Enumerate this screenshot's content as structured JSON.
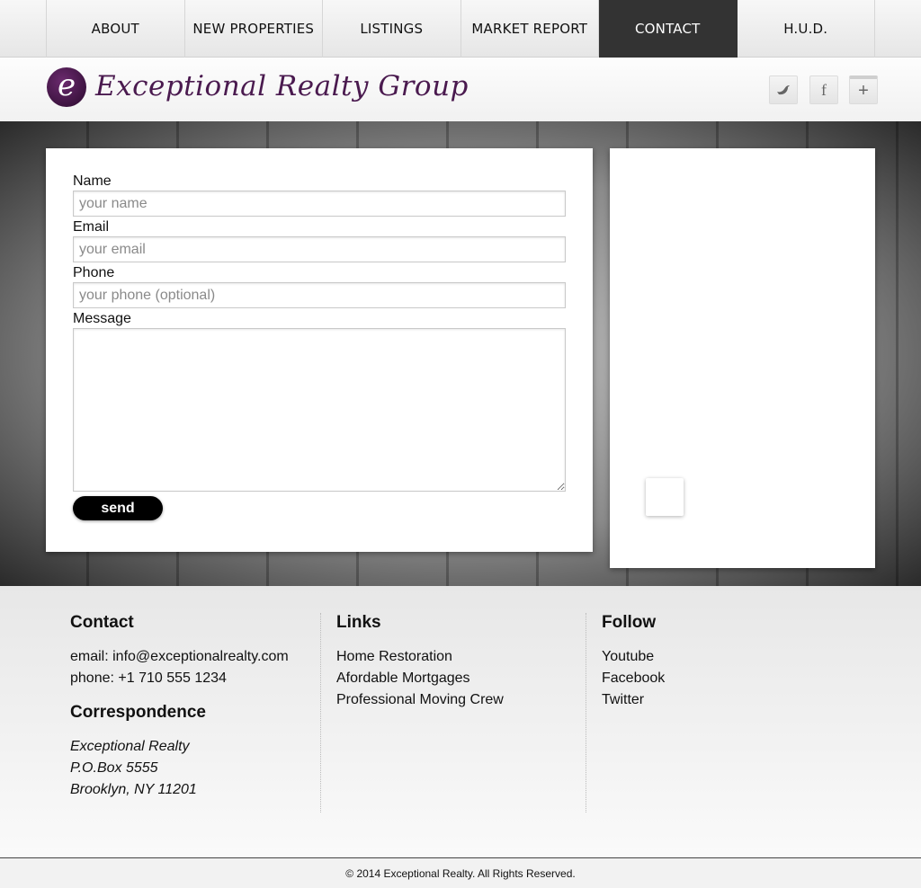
{
  "nav": {
    "items": [
      {
        "label": "ABOUT"
      },
      {
        "label": "NEW PROPERTIES"
      },
      {
        "label": "LISTINGS"
      },
      {
        "label": "MARKET REPORT"
      },
      {
        "label": "CONTACT",
        "active": true
      },
      {
        "label": "H.U.D."
      }
    ]
  },
  "header": {
    "logo_glyph": "e",
    "brand_name": "Exceptional Realty Group",
    "social": [
      {
        "icon": "twitter-icon",
        "glyph": "🐦"
      },
      {
        "icon": "facebook-icon",
        "glyph": "f"
      },
      {
        "icon": "google-plus-icon",
        "glyph": "+"
      }
    ]
  },
  "form": {
    "name_label": "Name",
    "name_placeholder": "your name",
    "email_label": "Email",
    "email_placeholder": "your email",
    "phone_label": "Phone",
    "phone_placeholder": "your phone (optional)",
    "message_label": "Message",
    "send_label": "send"
  },
  "footer": {
    "contact": {
      "heading": "Contact",
      "email": "email: info@exceptionalrealty.com",
      "phone": "phone: +1 710 555 1234"
    },
    "correspondence": {
      "heading": "Correspondence",
      "lines": [
        "Exceptional Realty",
        "P.O.Box 5555",
        "Brooklyn, NY 11201"
      ]
    },
    "links": {
      "heading": "Links",
      "items": [
        "Home Restoration",
        "Afordable Mortgages",
        "Professional Moving Crew"
      ]
    },
    "follow": {
      "heading": "Follow",
      "items": [
        "Youtube",
        "Facebook",
        "Twitter"
      ]
    },
    "copyright": "© 2014 Exceptional Realty. All Rights Reserved."
  },
  "colors": {
    "nav_active_bg": "#333333",
    "brand": "#4a1a4f",
    "button_bg": "#000000"
  }
}
